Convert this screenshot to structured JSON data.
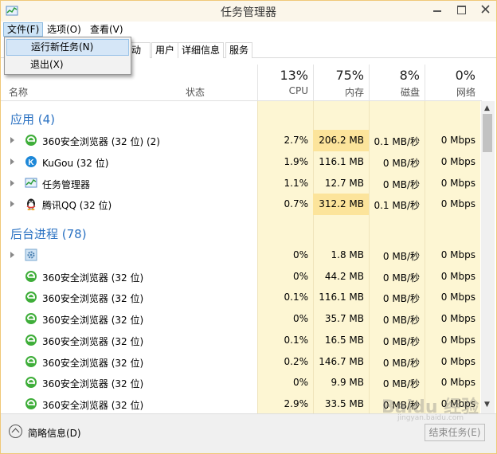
{
  "window": {
    "title": "任务管理器"
  },
  "menu": {
    "file": "文件(F)",
    "options": "选项(O)",
    "view": "查看(V)"
  },
  "file_menu": {
    "run_new_task": "运行新任务(N)",
    "exit": "退出(X)"
  },
  "tabs": {
    "startup": "启动",
    "users": "用户",
    "details": "详细信息",
    "services": "服务"
  },
  "columns": {
    "name": "名称",
    "status": "状态",
    "cpu": {
      "pct": "13%",
      "label": "CPU"
    },
    "memory": {
      "pct": "75%",
      "label": "内存"
    },
    "disk": {
      "pct": "8%",
      "label": "磁盘"
    },
    "network": {
      "pct": "0%",
      "label": "网络"
    }
  },
  "groups": {
    "apps": "应用 (4)",
    "background": "后台进程 (78)"
  },
  "apps": [
    {
      "icon": "360-browser-icon",
      "name": "360安全浏览器 (32 位) (2)",
      "cpu": "2.7%",
      "mem": "206.2 MB",
      "disk": "0.1 MB/秒",
      "net": "0 Mbps"
    },
    {
      "icon": "kugou-icon",
      "name": "KuGou (32 位)",
      "cpu": "1.9%",
      "mem": "116.1 MB",
      "disk": "0 MB/秒",
      "net": "0 Mbps"
    },
    {
      "icon": "task-manager-icon",
      "name": "任务管理器",
      "cpu": "1.1%",
      "mem": "12.7 MB",
      "disk": "0 MB/秒",
      "net": "0 Mbps"
    },
    {
      "icon": "qq-penguin-icon",
      "name": "腾讯QQ (32 位)",
      "cpu": "0.7%",
      "mem": "312.2 MB",
      "disk": "0.1 MB/秒",
      "net": "0 Mbps"
    }
  ],
  "background": [
    {
      "icon": "gear-icon",
      "name": "",
      "cpu": "0%",
      "mem": "1.8 MB",
      "disk": "0 MB/秒",
      "net": "0 Mbps"
    },
    {
      "icon": "360-browser-icon",
      "name": "360安全浏览器 (32 位)",
      "cpu": "0%",
      "mem": "44.2 MB",
      "disk": "0 MB/秒",
      "net": "0 Mbps"
    },
    {
      "icon": "360-browser-icon",
      "name": "360安全浏览器 (32 位)",
      "cpu": "0.1%",
      "mem": "116.1 MB",
      "disk": "0 MB/秒",
      "net": "0 Mbps"
    },
    {
      "icon": "360-browser-icon",
      "name": "360安全浏览器 (32 位)",
      "cpu": "0%",
      "mem": "35.7 MB",
      "disk": "0 MB/秒",
      "net": "0 Mbps"
    },
    {
      "icon": "360-browser-icon",
      "name": "360安全浏览器 (32 位)",
      "cpu": "0.1%",
      "mem": "16.5 MB",
      "disk": "0 MB/秒",
      "net": "0 Mbps"
    },
    {
      "icon": "360-browser-icon",
      "name": "360安全浏览器 (32 位)",
      "cpu": "0.2%",
      "mem": "146.7 MB",
      "disk": "0 MB/秒",
      "net": "0 Mbps"
    },
    {
      "icon": "360-browser-icon",
      "name": "360安全浏览器 (32 位)",
      "cpu": "0%",
      "mem": "9.9 MB",
      "disk": "0 MB/秒",
      "net": "0 Mbps"
    },
    {
      "icon": "360-browser-icon",
      "name": "360安全浏览器 (32 位)",
      "cpu": "2.9%",
      "mem": "33.5 MB",
      "disk": "0 MB/秒",
      "net": "0 Mbps"
    }
  ],
  "footer": {
    "fewer_details": "简略信息(D)",
    "end_task": "结束任务(E)"
  },
  "watermark": {
    "logo": "Baidu 经验",
    "url": "jingyan.baidu.com"
  },
  "colors": {
    "accent": "#2a71c2",
    "heat_light": "#fdf6d3",
    "heat_strong": "#fce49b"
  }
}
